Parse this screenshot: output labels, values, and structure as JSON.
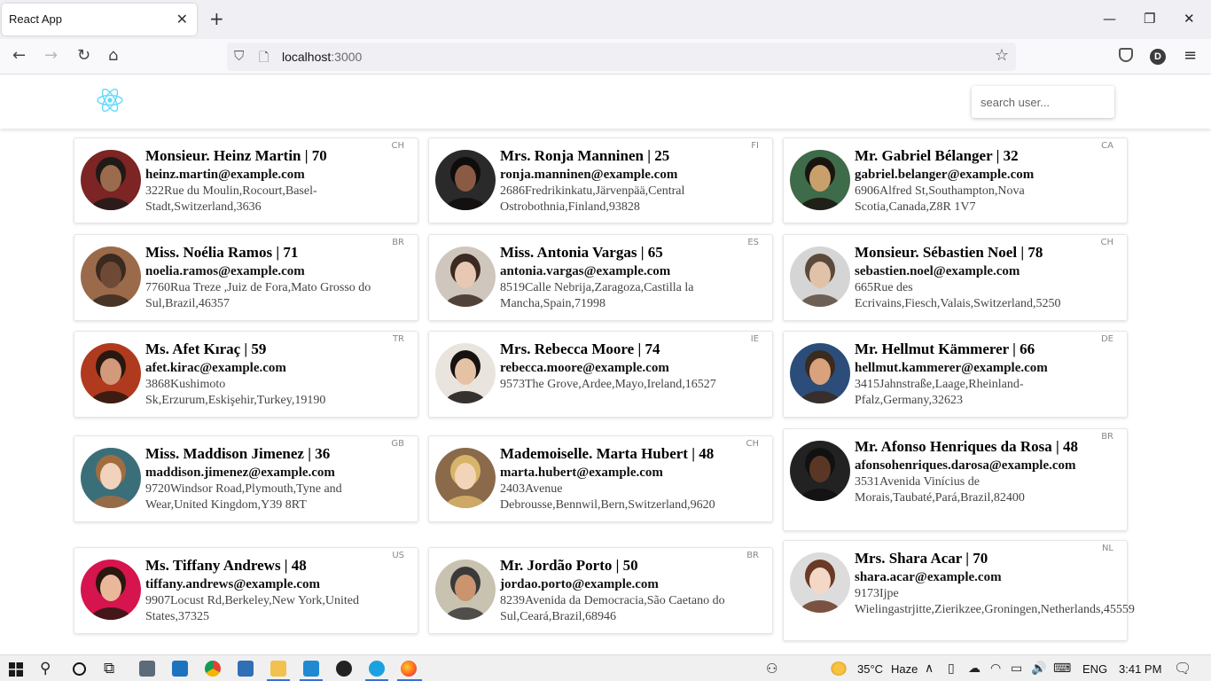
{
  "browser": {
    "tab_title": "React App",
    "tab_close": "✕",
    "new_tab": "+",
    "window_controls": {
      "minimize": "—",
      "restore": "❐",
      "close": "✕"
    },
    "nav": {
      "back": "←",
      "forward": "→",
      "reload": "↻",
      "home": "⌂"
    },
    "url_host": "localhost",
    "url_port": ":3000",
    "bookmark_star": "☆",
    "profile_initial": "D",
    "menu": "≡"
  },
  "app": {
    "search_placeholder": "search user...",
    "brand_color": "#61dafb"
  },
  "users": [
    {
      "name": "Monsieur. Heinz Martin | 70",
      "email": "heinz.martin@example.com",
      "address": "322Rue du Moulin,Rocourt,Basel-Stadt,Switzerland,3636",
      "nat": "CH"
    },
    {
      "name": "Mrs. Ronja Manninen | 25",
      "email": "ronja.manninen@example.com",
      "address": "2686Fredrikinkatu,Järvenpää,Central Ostrobothnia,Finland,93828",
      "nat": "FI"
    },
    {
      "name": "Mr. Gabriel Bélanger | 32",
      "email": "gabriel.belanger@example.com",
      "address": "6906Alfred St,Southampton,Nova Scotia,Canada,Z8R 1V7",
      "nat": "CA"
    },
    {
      "name": "Miss. Noélia Ramos | 71",
      "email": "noelia.ramos@example.com",
      "address": "7760Rua Treze ,Juiz de Fora,Mato Grosso do Sul,Brazil,46357",
      "nat": "BR"
    },
    {
      "name": "Miss. Antonia Vargas | 65",
      "email": "antonia.vargas@example.com",
      "address": "8519Calle Nebrija,Zaragoza,Castilla la Mancha,Spain,71998",
      "nat": "ES"
    },
    {
      "name": "Monsieur. Sébastien Noel | 78",
      "email": "sebastien.noel@example.com",
      "address": "665Rue des Ecrivains,Fiesch,Valais,Switzerland,5250",
      "nat": "CH"
    },
    {
      "name": "Ms. Afet Kıraç | 59",
      "email": "afet.kirac@example.com",
      "address": "3868Kushimoto Sk,Erzurum,Eskişehir,Turkey,19190",
      "nat": "TR"
    },
    {
      "name": "Mrs. Rebecca Moore | 74",
      "email": "rebecca.moore@example.com",
      "address": "9573The Grove,Ardee,Mayo,Ireland,16527",
      "nat": "IE"
    },
    {
      "name": "Mr. Hellmut Kämmerer | 66",
      "email": "hellmut.kammerer@example.com",
      "address": "3415Jahnstraße,Laage,Rheinland-Pfalz,Germany,32623",
      "nat": "DE"
    },
    {
      "name": "Miss. Maddison Jimenez | 36",
      "email": "maddison.jimenez@example.com",
      "address": "9720Windsor Road,Plymouth,Tyne and Wear,United Kingdom,Y39 8RT",
      "nat": "GB"
    },
    {
      "name": "Mademoiselle. Marta Hubert | 48",
      "email": "marta.hubert@example.com",
      "address": "2403Avenue Debrousse,Bennwil,Bern,Switzerland,9620",
      "nat": "CH"
    },
    {
      "name": "Mr. Afonso Henriques da Rosa | 48",
      "email": "afonsohenriques.darosa@example.com",
      "address": "3531Avenida Vinícius de Morais,Taubaté,Pará,Brazil,82400",
      "nat": "BR"
    },
    {
      "name": "Ms. Tiffany Andrews | 48",
      "email": "tiffany.andrews@example.com",
      "address": "9907Locust Rd,Berkeley,New York,United States,37325",
      "nat": "US"
    },
    {
      "name": "Mr. Jordão Porto | 50",
      "email": "jordao.porto@example.com",
      "address": "8239Avenida da Democracia,São Caetano do Sul,Ceará,Brazil,68946",
      "nat": "BR"
    },
    {
      "name": "Mrs. Shara Acar | 70",
      "email": "shara.acar@example.com",
      "address": "9173Ijpe Wielingastrjitte,Zierikzee,Groningen,Netherlands,45559",
      "nat": "NL"
    }
  ],
  "taskbar": {
    "weather_temp": "35°C",
    "weather_text": "Haze",
    "language": "ENG",
    "time": "3:41 PM"
  }
}
